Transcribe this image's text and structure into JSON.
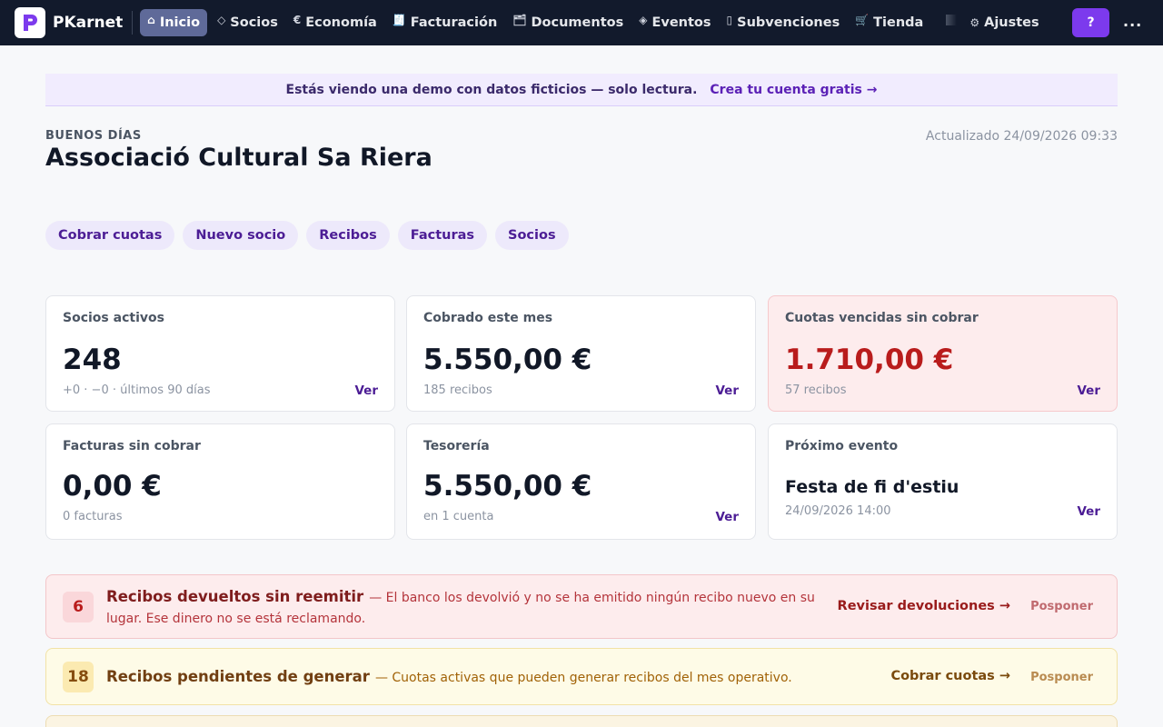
{
  "brand": {
    "name": "PKarnet",
    "logo_letter": "P"
  },
  "nav": {
    "items": [
      {
        "label": "Inicio",
        "icon": "⌂",
        "icon_name": "home-icon",
        "active": true
      },
      {
        "label": "Socios",
        "icon": "◇",
        "icon_name": "diamond-icon"
      },
      {
        "label": "Economía",
        "icon": "€",
        "icon_name": "euro-icon"
      },
      {
        "label": "Facturación",
        "icon": "🧾",
        "icon_name": "receipt-icon"
      },
      {
        "label": "Documentos",
        "icon": "🗂",
        "icon_name": "folder-icon"
      },
      {
        "label": "Eventos",
        "icon": "◈",
        "icon_name": "event-diamond-icon"
      },
      {
        "label": "Subvenciones",
        "icon": "▯",
        "icon_name": "grant-icon"
      },
      {
        "label": "Tienda",
        "icon": "🛒",
        "icon_name": "cart-icon"
      }
    ],
    "settings_label": "Ajustes",
    "settings_icon": "⚙",
    "help_label": "?",
    "more_label": "..."
  },
  "demo_banner": {
    "text": "Estás viendo una demo con datos ficticios — solo lectura.",
    "link": "Crea tu cuenta gratis →"
  },
  "header": {
    "greeting": "BUENOS DÍAS",
    "org_name": "Associació Cultural Sa Riera",
    "updated": "Actualizado 24/09/2026 09:33"
  },
  "quick_actions": [
    "Cobrar cuotas",
    "Nuevo socio",
    "Recibos",
    "Facturas",
    "Socios"
  ],
  "cards": {
    "socios": {
      "label": "Socios activos",
      "value": "248",
      "sub": "+0 · −0 · últimos 90 días",
      "link": "Ver"
    },
    "cobrado": {
      "label": "Cobrado este mes",
      "value": "5.550,00 €",
      "sub": "185 recibos",
      "link": "Ver"
    },
    "vencidas": {
      "label": "Cuotas vencidas sin cobrar",
      "value": "1.710,00 €",
      "sub": "57 recibos",
      "link": "Ver"
    },
    "facturas": {
      "label": "Facturas sin cobrar",
      "value": "0,00 €",
      "sub": "0 facturas"
    },
    "tesoreria": {
      "label": "Tesorería",
      "value": "5.550,00 €",
      "sub": "en 1 cuenta",
      "link": "Ver"
    },
    "evento": {
      "label": "Próximo evento",
      "value": "Festa de fi d'estiu",
      "sub": "24/09/2026 14:00",
      "link": "Ver"
    }
  },
  "alerts": [
    {
      "count": "6",
      "title": "Recibos devueltos sin reemitir",
      "desc": "— El banco los devolvió y no se ha emitido ningún recibo nuevo en su lugar. Ese dinero no se está reclamando.",
      "action": "Revisar devoluciones →",
      "dismiss": "Posponer"
    },
    {
      "count": "18",
      "title": "Recibos pendientes de generar",
      "desc": "— Cuotas activas que pueden generar recibos del mes operativo.",
      "action": "Cobrar cuotas →",
      "dismiss": "Posponer"
    }
  ],
  "colors": {
    "nav_bg": "#121a2c",
    "accent": "#7c3aed",
    "danger": "#b91c1c",
    "warning": "#a16207"
  }
}
